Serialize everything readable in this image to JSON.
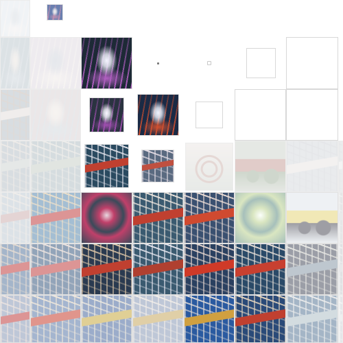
{
  "palette": {
    "water": "#5d7fa0",
    "red": "#c23a22",
    "dark": "#1f2430",
    "foam": "#f1f1f1",
    "teal": "#3c8a8a",
    "yellow": "#d2b53a",
    "green": "#5a7a3a",
    "purple": "#8a4fa8",
    "sand": "#c8b58a"
  },
  "tiles": [
    {
      "name": "tile-r0-c0",
      "state": "pale",
      "motif": "fountain",
      "colors": [
        "#c8d8e8",
        "#e8e0e0",
        "#b0c0d0"
      ]
    },
    {
      "name": "tile-r0-c1-tiny",
      "state": "full",
      "motif": "fountain",
      "colors": [
        "#6a7fb0",
        "#c090b0",
        "#f0f0f0"
      ]
    },
    {
      "name": "tile-r1-c0",
      "state": "pale",
      "motif": "fountain",
      "colors": [
        "#7a9ab0",
        "#a0b8c8",
        "#e0d0c0"
      ]
    },
    {
      "name": "tile-r1-c1",
      "state": "pale",
      "motif": "fountain",
      "colors": [
        "#c8b8d0",
        "#e8d8d0",
        "#a0b0c8"
      ]
    },
    {
      "name": "tile-r1-c2",
      "state": "full",
      "motif": "fountain",
      "colors": [
        "#1d2a36",
        "#b05fc0",
        "#f4f4ff"
      ]
    },
    {
      "name": "tile-r1-c5-empty",
      "state": "empty"
    },
    {
      "name": "tile-r1-c6-empty",
      "state": "empty"
    },
    {
      "name": "tile-r2-c0",
      "state": "pale",
      "motif": "boat",
      "colors": [
        "#6a8aa0",
        "#d0c0b8",
        "#a07a60"
      ]
    },
    {
      "name": "tile-r2-c1",
      "state": "pale",
      "motif": "fountain",
      "colors": [
        "#c0a8b0",
        "#a0b8c8",
        "#e8d8c8"
      ]
    },
    {
      "name": "tile-r2-c2-small",
      "state": "full",
      "motif": "fountain",
      "colors": [
        "#2a3340",
        "#a04fb0",
        "#f8f8ff"
      ]
    },
    {
      "name": "tile-r2-c3-small",
      "state": "full",
      "motif": "fountain",
      "colors": [
        "#1a2a45",
        "#d05030",
        "#f0f4ff"
      ]
    },
    {
      "name": "tile-r2-c4-empty",
      "state": "empty"
    },
    {
      "name": "tile-r2-c5-empty",
      "state": "empty"
    },
    {
      "name": "tile-r2-c6-empty",
      "state": "empty"
    },
    {
      "name": "tile-r3-c0",
      "state": "pale",
      "motif": "boat",
      "colors": [
        "#6a8aa0",
        "#a0b0a8",
        "#c8b8a8"
      ]
    },
    {
      "name": "tile-r3-c1",
      "state": "pale",
      "motif": "boat",
      "colors": [
        "#5a8a98",
        "#90a890",
        "#c8c0b0"
      ]
    },
    {
      "name": "tile-r3-c2-small",
      "state": "full",
      "motif": "boat",
      "colors": [
        "#2a4a60",
        "#c04030",
        "#e8e8f0"
      ]
    },
    {
      "name": "tile-r3-c3-small",
      "state": "full",
      "motif": "boat",
      "colors": [
        "#5a6a80",
        "#c05040",
        "#e8e0e8"
      ]
    },
    {
      "name": "tile-r3-c4",
      "state": "pale",
      "motif": "wheel",
      "colors": [
        "#c07060",
        "#a8b8a8",
        "#e0d0c8"
      ]
    },
    {
      "name": "tile-r3-c5",
      "state": "pale",
      "motif": "tractor",
      "colors": [
        "#4a7a3a",
        "#c04030",
        "#a0b098"
      ]
    },
    {
      "name": "tile-r3-c6",
      "state": "pale",
      "motif": "boat",
      "colors": [
        "#b0b8c8",
        "#d8d0c8",
        "#a0a8b8"
      ]
    },
    {
      "name": "tile-r3-c7",
      "state": "pale",
      "motif": "boat",
      "colors": [
        "#b8c0c8",
        "#d8d8d8",
        "#a8b0b8"
      ]
    },
    {
      "name": "tile-r4-c0",
      "state": "pale",
      "motif": "boat",
      "colors": [
        "#7a9ab8",
        "#c06060",
        "#d0c0b0"
      ]
    },
    {
      "name": "tile-r4-c1",
      "state": "faint",
      "motif": "boat",
      "colors": [
        "#5a8ab0",
        "#c04040",
        "#e0c8a0"
      ]
    },
    {
      "name": "tile-r4-c2",
      "state": "full",
      "motif": "creature",
      "colors": [
        "#3a4a5a",
        "#c0406a",
        "#e8d8e0"
      ]
    },
    {
      "name": "tile-r4-c3",
      "state": "full",
      "motif": "boat",
      "colors": [
        "#3a5a70",
        "#c04030",
        "#f0e8e0"
      ]
    },
    {
      "name": "tile-r4-c4",
      "state": "full",
      "motif": "boat",
      "colors": [
        "#3a5070",
        "#d04a30",
        "#f0e0d8"
      ]
    },
    {
      "name": "tile-r4-c5",
      "state": "dim",
      "motif": "creature",
      "colors": [
        "#3a7a70",
        "#a0c060",
        "#e0e8e0"
      ]
    },
    {
      "name": "tile-r4-c6",
      "state": "dim",
      "motif": "tractor",
      "colors": [
        "#3a3a48",
        "#d8c040",
        "#c8d0d8"
      ]
    },
    {
      "name": "tile-r4-c7",
      "state": "pale",
      "motif": "boat",
      "colors": [
        "#a0a8b0",
        "#b0b8b8",
        "#d0d0d0"
      ]
    },
    {
      "name": "tile-r5-c0",
      "state": "faint",
      "motif": "boat",
      "colors": [
        "#5a7aa0",
        "#c04040",
        "#d0c0b0"
      ]
    },
    {
      "name": "tile-r5-c1",
      "state": "faint",
      "motif": "boat",
      "colors": [
        "#3a5a80",
        "#c04040",
        "#e0d0c8"
      ]
    },
    {
      "name": "tile-r5-c2",
      "state": "full",
      "motif": "boat",
      "colors": [
        "#2a3a50",
        "#c04030",
        "#e0c8a8"
      ]
    },
    {
      "name": "tile-r5-c3",
      "state": "full",
      "motif": "boat",
      "colors": [
        "#3a5a70",
        "#b04030",
        "#e8e8f0"
      ]
    },
    {
      "name": "tile-r5-c4",
      "state": "full",
      "motif": "boat",
      "colors": [
        "#2a4060",
        "#d03a28",
        "#e8d8d0"
      ]
    },
    {
      "name": "tile-r5-c5",
      "state": "full",
      "motif": "boat",
      "colors": [
        "#2a4a68",
        "#c84030",
        "#e8e0d8"
      ]
    },
    {
      "name": "tile-r5-c6",
      "state": "faint",
      "motif": "boat",
      "colors": [
        "#4a5060",
        "#8a9aa8",
        "#d8d8d0"
      ]
    },
    {
      "name": "tile-r5-c7",
      "state": "pale",
      "motif": "boat",
      "colors": [
        "#909aa8",
        "#b0b0b8",
        "#d0d0d0"
      ]
    },
    {
      "name": "tile-r6-c0",
      "state": "faint",
      "motif": "boat",
      "colors": [
        "#8a9ab8",
        "#c04040",
        "#e0d0c8"
      ]
    },
    {
      "name": "tile-r6-c1",
      "state": "faint",
      "motif": "boat",
      "colors": [
        "#5a7aa8",
        "#c84030",
        "#e8d8c0"
      ]
    },
    {
      "name": "tile-r6-c2",
      "state": "faint",
      "motif": "boat",
      "colors": [
        "#4a6aa0",
        "#c8a840",
        "#e0d8c8"
      ]
    },
    {
      "name": "tile-r6-c3",
      "state": "faint",
      "motif": "boat",
      "colors": [
        "#8a9ab8",
        "#c8a860",
        "#e8e0d8"
      ]
    },
    {
      "name": "tile-r6-c4",
      "state": "full",
      "motif": "boat",
      "colors": [
        "#2a5aa0",
        "#d0a040",
        "#e8e0d8"
      ]
    },
    {
      "name": "tile-r6-c5",
      "state": "full",
      "motif": "boat",
      "colors": [
        "#2a4a78",
        "#c04030",
        "#e8d8c0"
      ]
    },
    {
      "name": "tile-r6-c6",
      "state": "faint",
      "motif": "boat",
      "colors": [
        "#5a7a98",
        "#b0c0c8",
        "#e0e0e0"
      ]
    },
    {
      "name": "tile-r6-c7",
      "state": "pale",
      "motif": "boat",
      "colors": [
        "#a0a8b8",
        "#c0c8d0",
        "#e0e0e0"
      ]
    }
  ]
}
